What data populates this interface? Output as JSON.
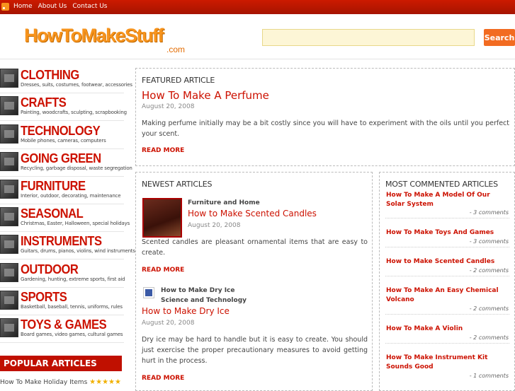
{
  "topnav": {
    "rss_icon": "rss-icon",
    "links": [
      "Home",
      "About Us",
      "Contact Us"
    ]
  },
  "header": {
    "logo_main": "HowToMakeStuff",
    "logo_suffix": ".com",
    "search_value": "",
    "search_button": "Search"
  },
  "sidebar": {
    "categories": [
      {
        "title": "CLOTHING",
        "sub": "Dresses, suits, costumes, footwear, accessories",
        "icon": "clothing-icon"
      },
      {
        "title": "CRAFTS",
        "sub": "Painting, woodcrafts, sculpting, scrapbooking",
        "icon": "crafts-icon"
      },
      {
        "title": "TECHNOLOGY",
        "sub": "Mobile phones, cameras, computers",
        "icon": "technology-icon"
      },
      {
        "title": "GOING GREEN",
        "sub": "Recycling, garbage disposal, waste segregation",
        "icon": "recycle-icon"
      },
      {
        "title": "FURNITURE",
        "sub": "Interior, outdoor, decorating, maintenance",
        "icon": "furniture-icon"
      },
      {
        "title": "SEASONAL",
        "sub": "Christmas, Easter, Halloween, special holidays",
        "icon": "seasonal-icon"
      },
      {
        "title": "INSTRUMENTS",
        "sub": "Guitars, drums, pianos, violins, wind instruments",
        "icon": "instruments-icon"
      },
      {
        "title": "OUTDOOR",
        "sub": "Gardening, hunting, extreme sports, first aid",
        "icon": "outdoor-icon"
      },
      {
        "title": "SPORTS",
        "sub": "Basketball, baseball, tennis, uniforms, rules",
        "icon": "sports-icon"
      },
      {
        "title": "TOYS & GAMES",
        "sub": "Board games, video games, cultural games",
        "icon": "toys-icon"
      }
    ],
    "popular_heading": "POPULAR ARTICLES",
    "popular_items": [
      {
        "label": "How To Make Holiday Items",
        "stars": "★★★★★"
      }
    ]
  },
  "featured": {
    "heading": "FEATURED ARTICLE",
    "title": "How To Make A Perfume",
    "date": "August 20, 2008",
    "excerpt": "Making perfume initially may be a bit costly since you will have to experiment with the oils until you perfect your scent.",
    "read_more": "READ MORE"
  },
  "newest": {
    "heading": "NEWEST ARTICLES",
    "articles": [
      {
        "category": "Furniture and Home",
        "title": "How to Make Scented Candles",
        "date": "August 20, 2008",
        "excerpt": "Scented candles are pleasant ornamental items that are easy to create.",
        "read_more": "READ MORE"
      },
      {
        "category_line1": "How to Make Dry Ice",
        "category_line2": "Science and Technology",
        "title": "How to Make Dry Ice",
        "date": "August 20, 2008",
        "excerpt": "Dry ice may be hard to handle but it is easy to create. You should just exercise the proper precautionary measures to avoid getting hurt in the process.",
        "read_more": "READ MORE"
      }
    ]
  },
  "most_commented": {
    "heading": "MOST COMMENTED ARTICLES",
    "items": [
      {
        "title": "How To Make A Model Of Our Solar System",
        "count": "- 3 comments"
      },
      {
        "title": "How To Make Toys And Games",
        "count": "- 3 comments"
      },
      {
        "title": "How to Make Scented Candles",
        "count": "- 2 comments"
      },
      {
        "title": "How To Make An Easy Chemical Volcano",
        "count": "- 2 comments"
      },
      {
        "title": "How To Make A Violin",
        "count": "- 2 comments"
      },
      {
        "title": "How To Make Instrument Kit Sounds Good",
        "count": "- 1 comments"
      }
    ]
  }
}
